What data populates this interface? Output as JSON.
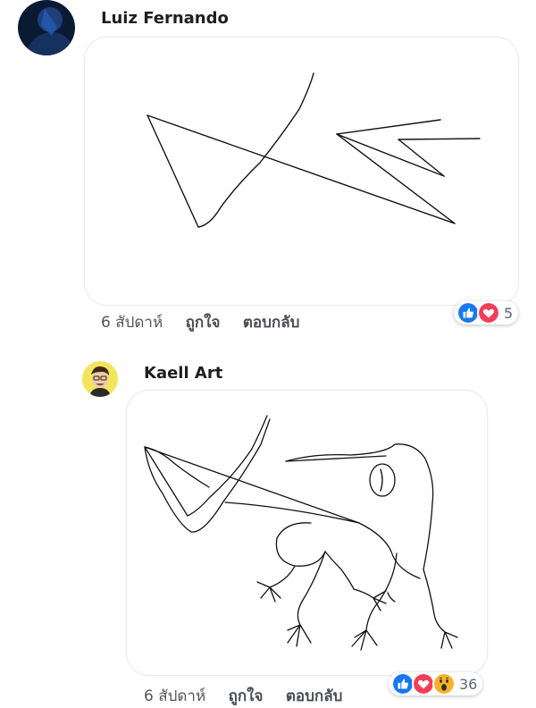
{
  "comments": [
    {
      "author": "Luiz Fernando",
      "icon": "avatar-dark",
      "time": "6 สัปดาห์",
      "like_label": "ถูกใจ",
      "reply_label": "ตอบกลับ",
      "reaction_icons": [
        "like-icon",
        "love-icon"
      ],
      "reaction_count": "5"
    },
    {
      "author": "Kaell Art",
      "icon": "avatar-cartoon",
      "time": "6 สัปดาห์",
      "like_label": "ถูกใจ",
      "reply_label": "ตอบกลับ",
      "reaction_icons": [
        "like-icon",
        "love-icon",
        "wow-icon"
      ],
      "reaction_count": "36"
    }
  ],
  "colors": {
    "like": "#1877f2",
    "love": "#f33e58",
    "wow": "#f7b125"
  }
}
